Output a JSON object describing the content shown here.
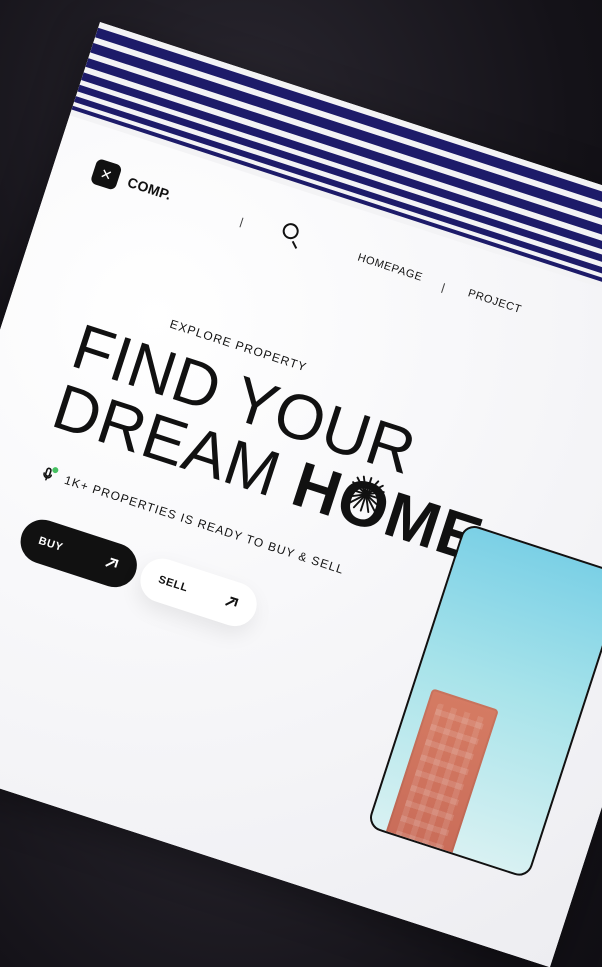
{
  "brand": {
    "name": "COMP.",
    "mark": "✕"
  },
  "nav": {
    "homepage": "HOMEPAGE",
    "project": "PROJECT"
  },
  "hero": {
    "eyebrow": "EXPLORE PROPERTY",
    "headline": {
      "line1": "FIND YOUR",
      "line2_prefix": "DREAM",
      "line2_strong": "HOME"
    },
    "subline": "1K+ PROPERTIES IS READY TO BUY & SELL"
  },
  "buttons": {
    "buy": "BUY",
    "sell": "SELL"
  },
  "colors": {
    "stripe": "#1d1b69",
    "ink": "#111111",
    "status_dot": "#47c062",
    "sky": "#7bd0e6",
    "building": "#d57b63"
  },
  "icons": {
    "brand": "brand-logo-icon",
    "search": "search-icon",
    "sparkle": "sparkle-icon",
    "microphone": "microphone-icon",
    "arrow": "arrow-up-right-icon"
  }
}
